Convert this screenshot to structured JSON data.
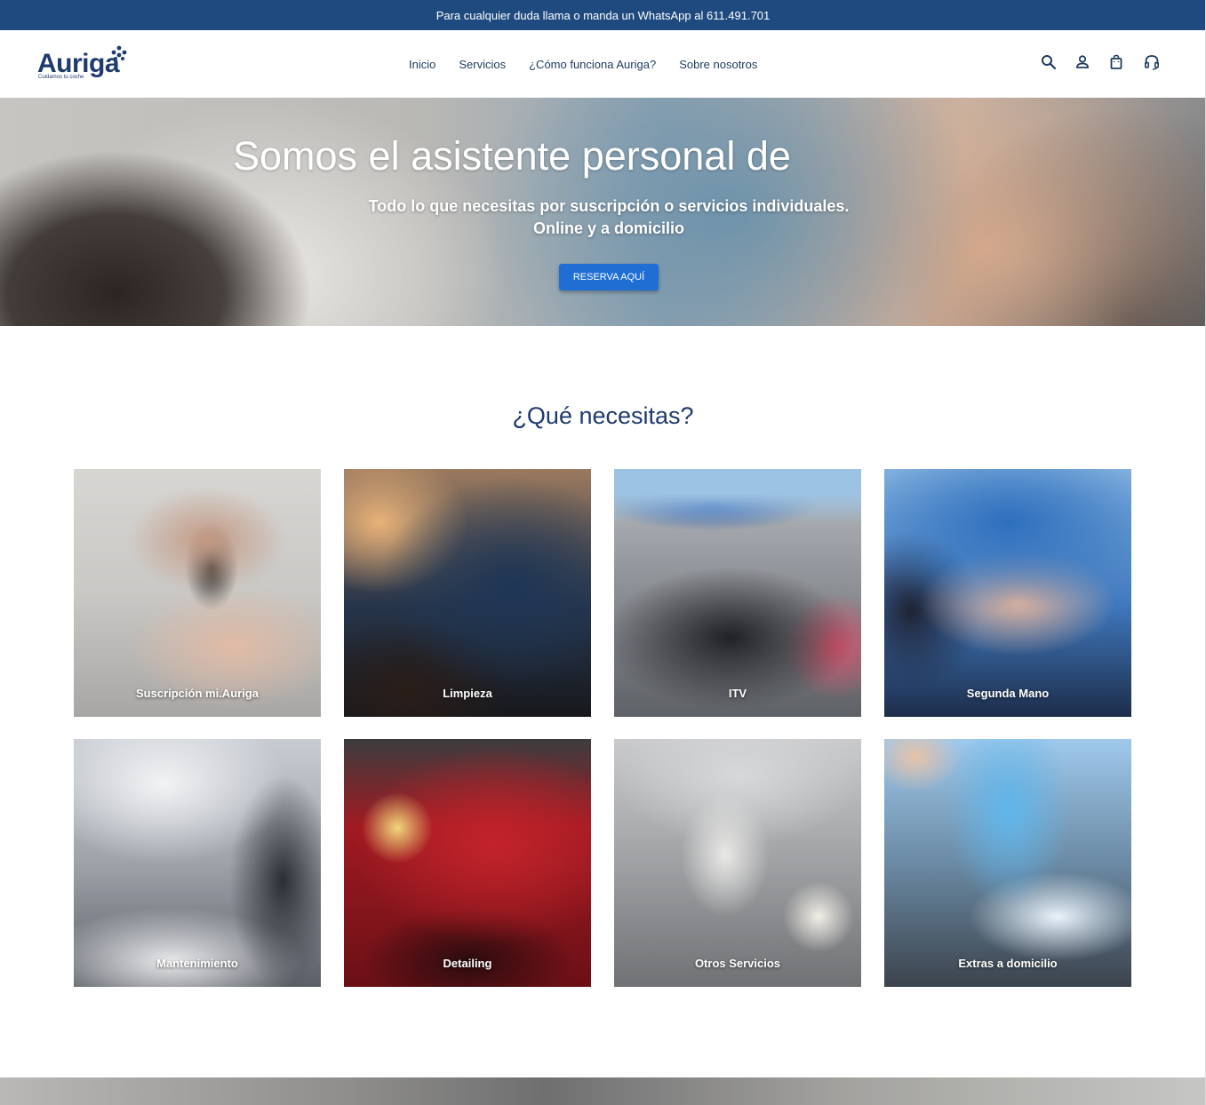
{
  "announcement": "Para cualquier duda llama o manda un WhatsApp al 611.491.701",
  "logo": {
    "name": "Auriga",
    "tagline": "Cuidamos tu coche"
  },
  "nav": {
    "items": [
      {
        "label": "Inicio"
      },
      {
        "label": "Servicios"
      },
      {
        "label": "¿Cómo funciona Auriga?"
      },
      {
        "label": "Sobre nosotros"
      }
    ]
  },
  "header_icons": [
    "search-icon",
    "account-icon",
    "cart-icon",
    "support-headset-icon"
  ],
  "hero": {
    "title": "Somos el asistente personal de",
    "subtitle_line1": "Todo lo que necesitas por suscripción o servicios individuales.",
    "subtitle_line2": "Online y a domicilio",
    "cta": "RESERVA AQUÍ"
  },
  "services": {
    "title": "¿Qué necesitas?",
    "items": [
      {
        "label": "Suscripción mi.Auriga"
      },
      {
        "label": "Limpieza"
      },
      {
        "label": "ITV"
      },
      {
        "label": "Segunda Mano"
      },
      {
        "label": "Mantenimiento"
      },
      {
        "label": "Detailing"
      },
      {
        "label": "Otros Servicios"
      },
      {
        "label": "Extras a domicilio"
      }
    ]
  },
  "colors": {
    "announcement_bg": "#1f4a80",
    "brand_navy": "#1f3b6e",
    "button_blue": "#1f6ed4"
  }
}
